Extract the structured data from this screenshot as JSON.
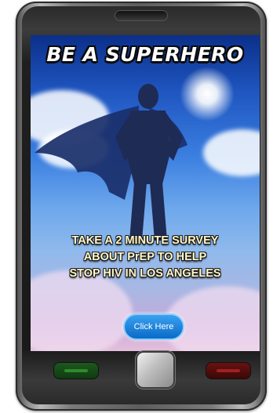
{
  "ad": {
    "headline": "BE A SUPERHERO",
    "body_lines": [
      "TAKE A 2 MINUTE SURVEY",
      "ABOUT PrEP TO HELP",
      "STOP HIV IN LOS ANGELES"
    ],
    "cta_label": "Click Here"
  },
  "icons": {
    "call_key": "phone-call-icon",
    "end_key": "phone-end-icon",
    "home_key": "home-button-icon"
  },
  "colors": {
    "sky_top": "#0b2f8a",
    "sky_bottom": "#e4bfdc",
    "cta_fill": "#0b6bc8",
    "call_key": "#1d5a1d",
    "end_key": "#6a1212",
    "subtitle_text": "#fff7c9"
  }
}
